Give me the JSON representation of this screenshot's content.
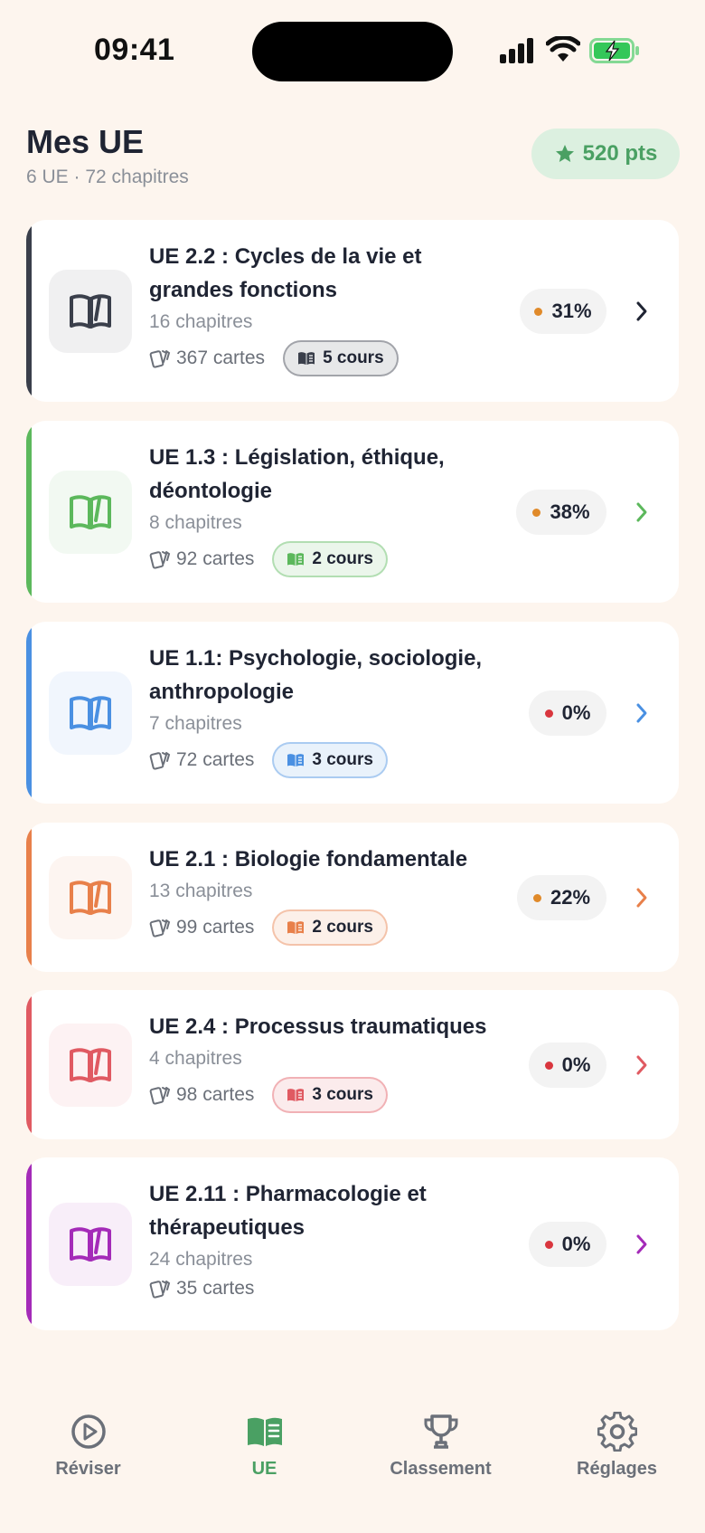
{
  "status_bar": {
    "time": "09:41"
  },
  "header": {
    "title": "Mes UE",
    "subtitle": "6 UE · 72 chapitres",
    "points": "520 pts"
  },
  "colors": {
    "background": "#fdf5ee",
    "accent_green": "#4aa063"
  },
  "ue_list": [
    {
      "title": "UE 2.2 : Cycles de la vie et grandes fonctions",
      "chapters": "16 chapitres",
      "cards": "367 cartes",
      "cours": "5 cours",
      "progress": "31%",
      "progress_value": 0.31,
      "color": "#3a3f4b",
      "dot_color": "#e08a2a",
      "icon": "open-book-icon"
    },
    {
      "title": "UE 1.3 : Législation, éthique, déontologie",
      "chapters": "8 chapitres",
      "cards": "92 cartes",
      "cours": "2 cours",
      "progress": "38%",
      "progress_value": 0.38,
      "color": "#5cb85c",
      "dot_color": "#e08a2a",
      "icon": "open-book-icon"
    },
    {
      "title": "UE 1.1: Psychologie, sociologie, anthropologie",
      "chapters": "7 chapitres",
      "cards": "72 cartes",
      "cours": "3 cours",
      "progress": "0%",
      "progress_value": 0,
      "color": "#4a90e2",
      "dot_color": "#d9363e",
      "icon": "open-book-icon"
    },
    {
      "title": "UE 2.1 : Biologie fondamentale",
      "chapters": "13 chapitres",
      "cards": "99 cartes",
      "cours": "2 cours",
      "progress": "22%",
      "progress_value": 0.22,
      "color": "#e8804a",
      "dot_color": "#e08a2a",
      "icon": "open-book-icon"
    },
    {
      "title": "UE 2.4 : Processus traumatiques",
      "chapters": "4 chapitres",
      "cards": "98 cartes",
      "cours": "3 cours",
      "progress": "0%",
      "progress_value": 0,
      "color": "#e05a62",
      "dot_color": "#d9363e",
      "icon": "open-book-icon"
    },
    {
      "title": "UE 2.11 : Pharmacologie et thérapeutiques",
      "chapters": "24 chapitres",
      "cards": "35 cartes",
      "cours": "",
      "progress": "0%",
      "progress_value": 0,
      "color": "#a42bb8",
      "dot_color": "#d9363e",
      "icon": "open-book-icon"
    }
  ],
  "tab_bar": {
    "tabs": [
      {
        "label": "Réviser",
        "icon": "play-circle-icon",
        "active": false
      },
      {
        "label": "UE",
        "icon": "book-icon",
        "active": true
      },
      {
        "label": "Classement",
        "icon": "trophy-icon",
        "active": false
      },
      {
        "label": "Réglages",
        "icon": "gear-icon",
        "active": false
      }
    ]
  }
}
